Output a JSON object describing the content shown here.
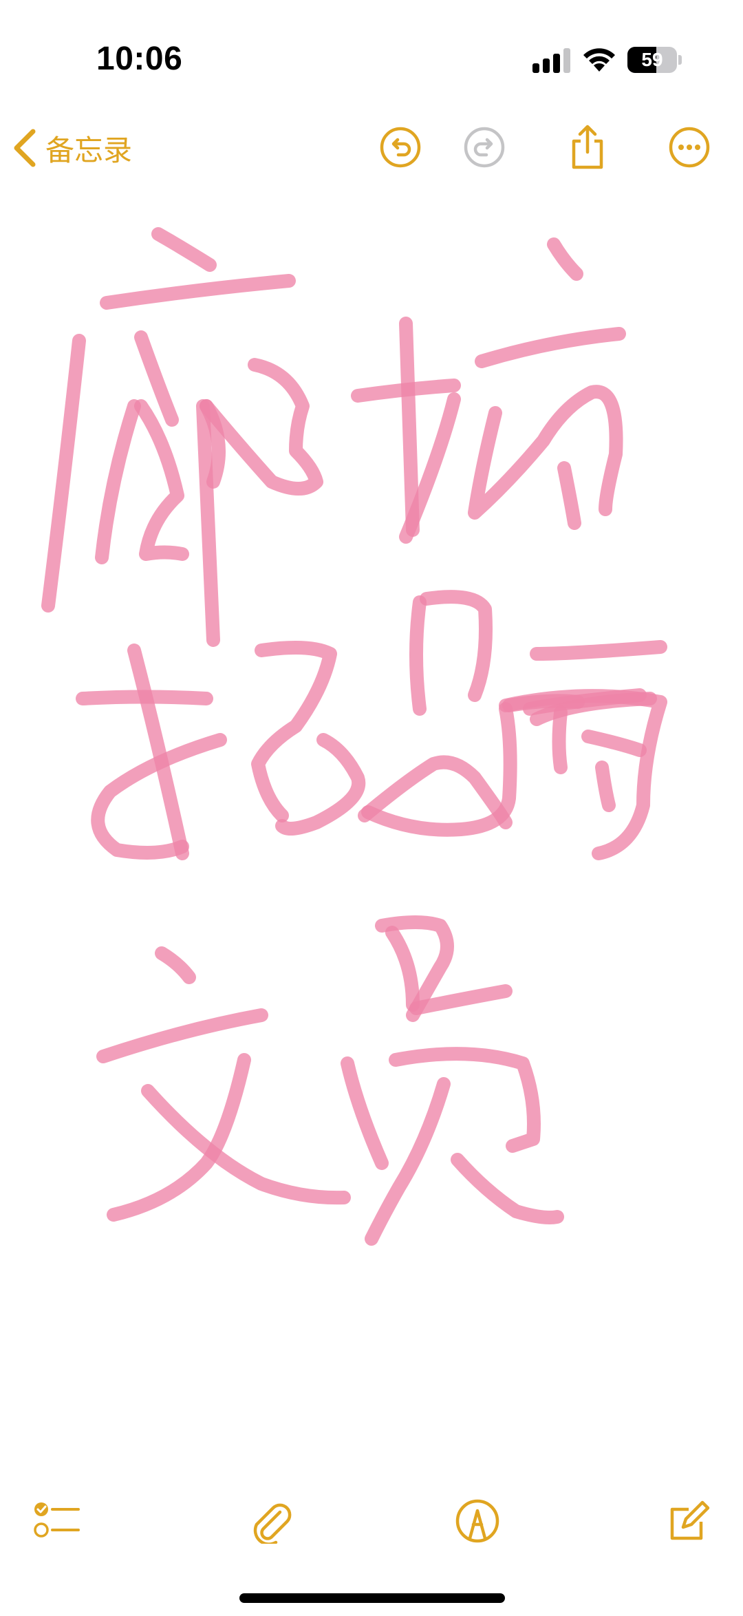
{
  "status_bar": {
    "time": "10:06",
    "battery_percent": "59",
    "battery_level": 0.59
  },
  "nav": {
    "back_label": "备忘录",
    "icons": [
      "chevron-left-icon",
      "undo-icon",
      "redo-icon",
      "share-icon",
      "more-icon"
    ]
  },
  "toolbar": {
    "icons": [
      "checklist-icon",
      "paperclip-icon",
      "markup-pen-icon",
      "compose-icon"
    ]
  },
  "colors": {
    "accent": "#e0a521",
    "ink": "#ee84a8",
    "disabled": "#c4c4c6"
  }
}
